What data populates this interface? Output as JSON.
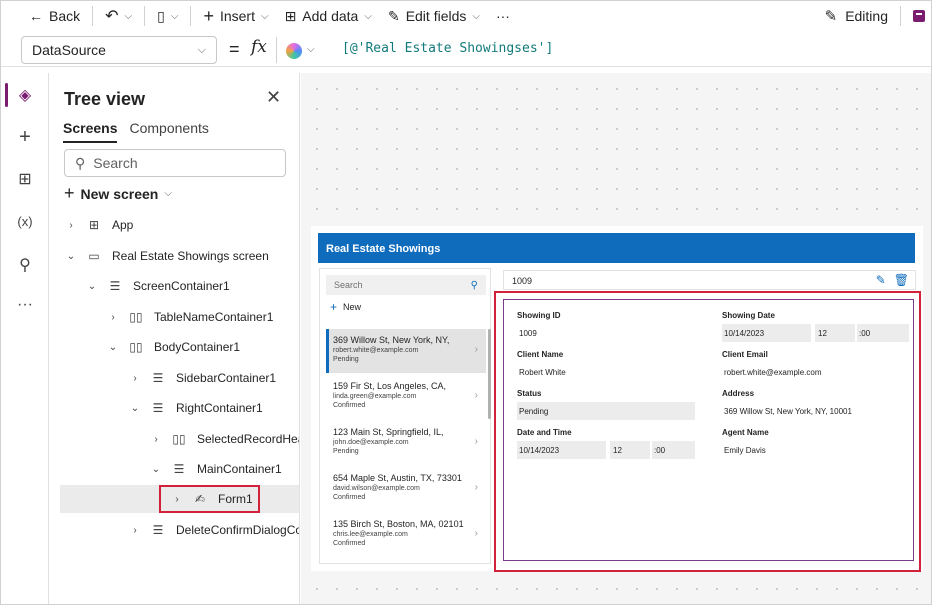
{
  "toolbar": {
    "back": "Back",
    "insert": "Insert",
    "add_data": "Add data",
    "edit_fields": "Edit fields",
    "more": "···",
    "editing": "Editing"
  },
  "formula_bar": {
    "property": "DataSource",
    "equals": "=",
    "fx": "fx",
    "formula": "[@'Real Estate Showingses']"
  },
  "tree_view": {
    "title": "Tree view",
    "tabs": [
      "Screens",
      "Components"
    ],
    "search_placeholder": "Search",
    "new_screen": "New screen",
    "nodes": [
      {
        "label": "App"
      },
      {
        "label": "Real Estate Showings screen"
      },
      {
        "label": "ScreenContainer1"
      },
      {
        "label": "TableNameContainer1"
      },
      {
        "label": "BodyContainer1"
      },
      {
        "label": "SidebarContainer1"
      },
      {
        "label": "RightContainer1"
      },
      {
        "label": "SelectedRecordHeader"
      },
      {
        "label": "MainContainer1"
      },
      {
        "label": "Form1"
      },
      {
        "label": "DeleteConfirmDialogConta"
      }
    ]
  },
  "app": {
    "header_title": "Real Estate Showings",
    "search_placeholder": "Search",
    "new_label": "New",
    "records": [
      {
        "address": "369 Willow St, New York, NY,",
        "email": "robert.white@example.com",
        "status": "Pending"
      },
      {
        "address": "159 Fir St, Los Angeles, CA,",
        "email": "linda.green@example.com",
        "status": "Confirmed"
      },
      {
        "address": "123 Main St, Springfield, IL,",
        "email": "john.doe@example.com",
        "status": "Pending"
      },
      {
        "address": "654 Maple St, Austin, TX, 73301",
        "email": "david.wilson@example.com",
        "status": "Confirmed"
      },
      {
        "address": "135 Birch St, Boston, MA, 02101",
        "email": "chris.lee@example.com",
        "status": "Confirmed"
      }
    ],
    "selected_header": "1009",
    "form": {
      "showing_id_label": "Showing ID",
      "showing_id": "1009",
      "showing_date_label": "Showing Date",
      "showing_date": "10/14/2023",
      "showing_hour": "12",
      "showing_min": ":00",
      "client_name_label": "Client Name",
      "client_name": "Robert White",
      "client_email_label": "Client Email",
      "client_email": "robert.white@example.com",
      "status_label": "Status",
      "status": "Pending",
      "address_label": "Address",
      "address": "369 Willow St, New York, NY, 10001",
      "date_time_label": "Date and Time",
      "date_time": "10/14/2023",
      "date_hour": "12",
      "date_min": ":00",
      "agent_label": "Agent Name",
      "agent": "Emily Davis"
    }
  }
}
